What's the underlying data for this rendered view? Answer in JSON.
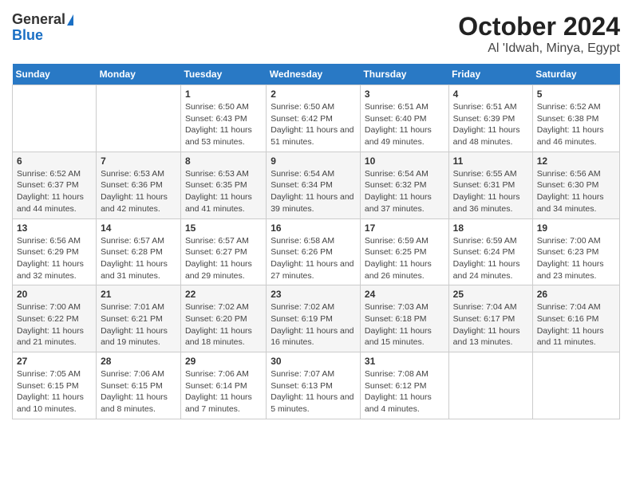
{
  "logo": {
    "general": "General",
    "blue": "Blue"
  },
  "title": "October 2024",
  "subtitle": "Al 'Idwah, Minya, Egypt",
  "weekdays": [
    "Sunday",
    "Monday",
    "Tuesday",
    "Wednesday",
    "Thursday",
    "Friday",
    "Saturday"
  ],
  "weeks": [
    [
      {
        "day": "",
        "detail": ""
      },
      {
        "day": "",
        "detail": ""
      },
      {
        "day": "1",
        "detail": "Sunrise: 6:50 AM\nSunset: 6:43 PM\nDaylight: 11 hours and 53 minutes."
      },
      {
        "day": "2",
        "detail": "Sunrise: 6:50 AM\nSunset: 6:42 PM\nDaylight: 11 hours and 51 minutes."
      },
      {
        "day": "3",
        "detail": "Sunrise: 6:51 AM\nSunset: 6:40 PM\nDaylight: 11 hours and 49 minutes."
      },
      {
        "day": "4",
        "detail": "Sunrise: 6:51 AM\nSunset: 6:39 PM\nDaylight: 11 hours and 48 minutes."
      },
      {
        "day": "5",
        "detail": "Sunrise: 6:52 AM\nSunset: 6:38 PM\nDaylight: 11 hours and 46 minutes."
      }
    ],
    [
      {
        "day": "6",
        "detail": "Sunrise: 6:52 AM\nSunset: 6:37 PM\nDaylight: 11 hours and 44 minutes."
      },
      {
        "day": "7",
        "detail": "Sunrise: 6:53 AM\nSunset: 6:36 PM\nDaylight: 11 hours and 42 minutes."
      },
      {
        "day": "8",
        "detail": "Sunrise: 6:53 AM\nSunset: 6:35 PM\nDaylight: 11 hours and 41 minutes."
      },
      {
        "day": "9",
        "detail": "Sunrise: 6:54 AM\nSunset: 6:34 PM\nDaylight: 11 hours and 39 minutes."
      },
      {
        "day": "10",
        "detail": "Sunrise: 6:54 AM\nSunset: 6:32 PM\nDaylight: 11 hours and 37 minutes."
      },
      {
        "day": "11",
        "detail": "Sunrise: 6:55 AM\nSunset: 6:31 PM\nDaylight: 11 hours and 36 minutes."
      },
      {
        "day": "12",
        "detail": "Sunrise: 6:56 AM\nSunset: 6:30 PM\nDaylight: 11 hours and 34 minutes."
      }
    ],
    [
      {
        "day": "13",
        "detail": "Sunrise: 6:56 AM\nSunset: 6:29 PM\nDaylight: 11 hours and 32 minutes."
      },
      {
        "day": "14",
        "detail": "Sunrise: 6:57 AM\nSunset: 6:28 PM\nDaylight: 11 hours and 31 minutes."
      },
      {
        "day": "15",
        "detail": "Sunrise: 6:57 AM\nSunset: 6:27 PM\nDaylight: 11 hours and 29 minutes."
      },
      {
        "day": "16",
        "detail": "Sunrise: 6:58 AM\nSunset: 6:26 PM\nDaylight: 11 hours and 27 minutes."
      },
      {
        "day": "17",
        "detail": "Sunrise: 6:59 AM\nSunset: 6:25 PM\nDaylight: 11 hours and 26 minutes."
      },
      {
        "day": "18",
        "detail": "Sunrise: 6:59 AM\nSunset: 6:24 PM\nDaylight: 11 hours and 24 minutes."
      },
      {
        "day": "19",
        "detail": "Sunrise: 7:00 AM\nSunset: 6:23 PM\nDaylight: 11 hours and 23 minutes."
      }
    ],
    [
      {
        "day": "20",
        "detail": "Sunrise: 7:00 AM\nSunset: 6:22 PM\nDaylight: 11 hours and 21 minutes."
      },
      {
        "day": "21",
        "detail": "Sunrise: 7:01 AM\nSunset: 6:21 PM\nDaylight: 11 hours and 19 minutes."
      },
      {
        "day": "22",
        "detail": "Sunrise: 7:02 AM\nSunset: 6:20 PM\nDaylight: 11 hours and 18 minutes."
      },
      {
        "day": "23",
        "detail": "Sunrise: 7:02 AM\nSunset: 6:19 PM\nDaylight: 11 hours and 16 minutes."
      },
      {
        "day": "24",
        "detail": "Sunrise: 7:03 AM\nSunset: 6:18 PM\nDaylight: 11 hours and 15 minutes."
      },
      {
        "day": "25",
        "detail": "Sunrise: 7:04 AM\nSunset: 6:17 PM\nDaylight: 11 hours and 13 minutes."
      },
      {
        "day": "26",
        "detail": "Sunrise: 7:04 AM\nSunset: 6:16 PM\nDaylight: 11 hours and 11 minutes."
      }
    ],
    [
      {
        "day": "27",
        "detail": "Sunrise: 7:05 AM\nSunset: 6:15 PM\nDaylight: 11 hours and 10 minutes."
      },
      {
        "day": "28",
        "detail": "Sunrise: 7:06 AM\nSunset: 6:15 PM\nDaylight: 11 hours and 8 minutes."
      },
      {
        "day": "29",
        "detail": "Sunrise: 7:06 AM\nSunset: 6:14 PM\nDaylight: 11 hours and 7 minutes."
      },
      {
        "day": "30",
        "detail": "Sunrise: 7:07 AM\nSunset: 6:13 PM\nDaylight: 11 hours and 5 minutes."
      },
      {
        "day": "31",
        "detail": "Sunrise: 7:08 AM\nSunset: 6:12 PM\nDaylight: 11 hours and 4 minutes."
      },
      {
        "day": "",
        "detail": ""
      },
      {
        "day": "",
        "detail": ""
      }
    ]
  ]
}
